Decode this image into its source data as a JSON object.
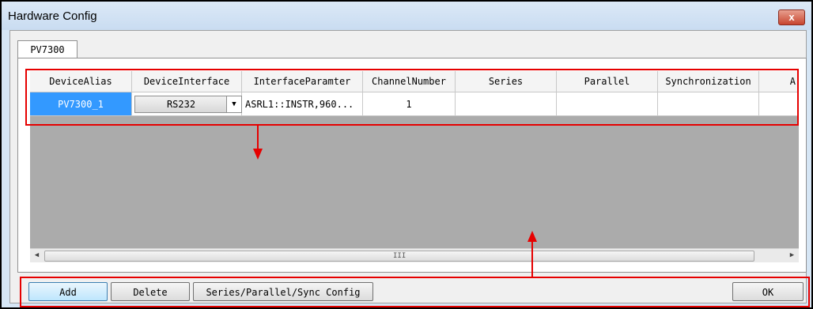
{
  "window": {
    "title": "Hardware Config",
    "close_label": "x"
  },
  "tabs": [
    {
      "label": "PV7300",
      "selected": true
    }
  ],
  "grid": {
    "columns": [
      "DeviceAlias",
      "DeviceInterface",
      "InterfaceParamter",
      "ChannelNumber",
      "Series",
      "Parallel",
      "Synchronization",
      "A"
    ],
    "rows": [
      {
        "device_alias": "PV7300_1",
        "device_interface": "RS232",
        "interface_paramter": "ASRL1::INSTR,960...",
        "channel_number": "1",
        "series": "",
        "parallel": "",
        "synchronization": "",
        "extra": ""
      }
    ]
  },
  "scrollbar": {
    "left_arrow": "◀",
    "right_arrow": "▶",
    "grip": "III"
  },
  "buttons": {
    "add": "Add",
    "delete": "Delete",
    "series_parallel_sync": "Series/Parallel/Sync Config",
    "ok": "OK"
  },
  "colors": {
    "annotation_red": "#e60000",
    "selection_blue": "#3399ff",
    "grid_background": "#ababab"
  }
}
